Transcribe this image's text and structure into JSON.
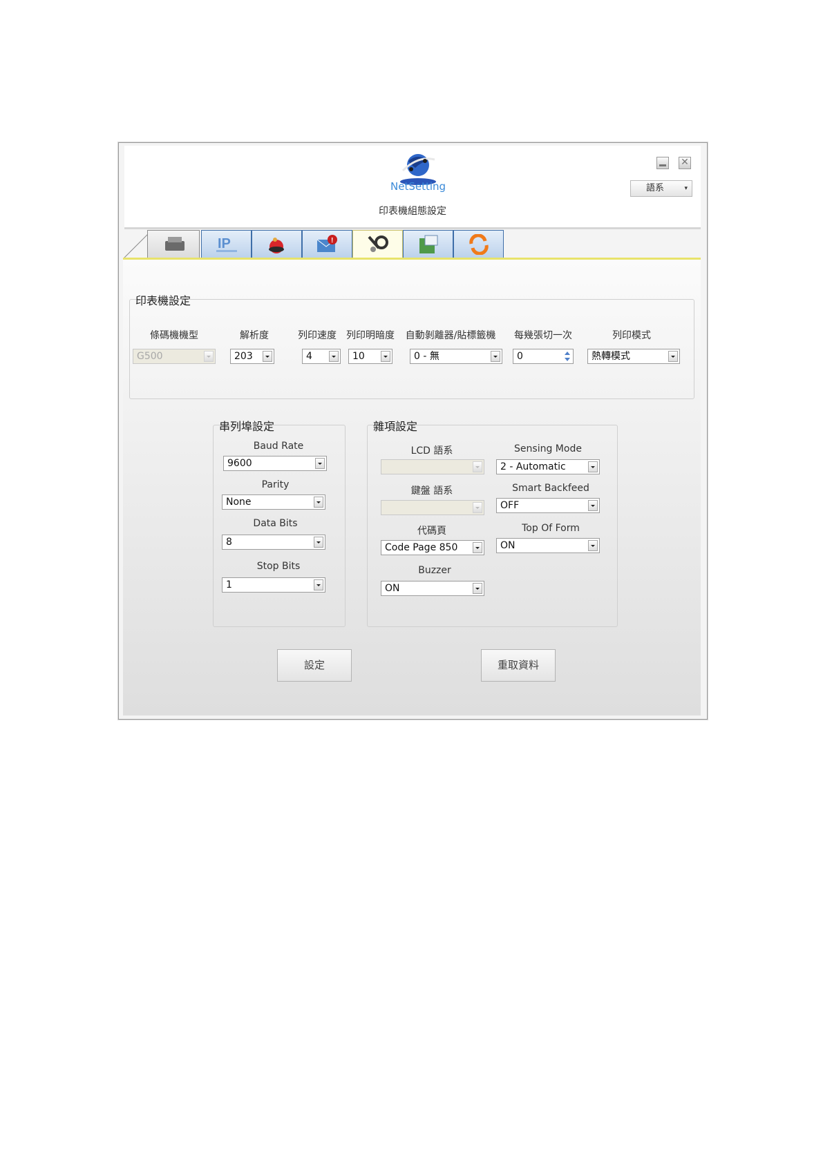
{
  "header": {
    "logo_text": "NetSetting",
    "subtitle": "印表機組態設定",
    "language_button": "語系",
    "minimize_icon": "minimize-icon",
    "close_icon": "close-icon"
  },
  "tabs": [
    {
      "icon": "printer-icon",
      "active": false
    },
    {
      "icon": "ip-network-icon",
      "active": false
    },
    {
      "icon": "red-ball-icon",
      "active": false
    },
    {
      "icon": "alert-mail-icon",
      "active": false
    },
    {
      "icon": "tools-gear-icon",
      "active": true
    },
    {
      "icon": "upload-file-icon",
      "active": false
    },
    {
      "icon": "refresh-icon",
      "active": false
    }
  ],
  "printer_settings": {
    "title": "印表機設定",
    "fields": [
      {
        "label": "條碼機機型",
        "value": "G500",
        "disabled": true
      },
      {
        "label": "解析度",
        "value": "203"
      },
      {
        "label": "列印速度",
        "value": "4"
      },
      {
        "label": "列印明暗度",
        "value": "10"
      },
      {
        "label": "自動剝離器/貼標籤機",
        "value": "0 - 無"
      },
      {
        "label": "每幾張切一次",
        "value": "0"
      },
      {
        "label": "列印模式",
        "value": "熱轉模式"
      }
    ]
  },
  "serial_settings": {
    "title": "串列埠設定",
    "fields": [
      {
        "label": "Baud Rate",
        "value": "9600"
      },
      {
        "label": "Parity",
        "value": "None"
      },
      {
        "label": "Data Bits",
        "value": "8"
      },
      {
        "label": "Stop Bits",
        "value": "1"
      }
    ]
  },
  "misc_settings": {
    "title": "雜項設定",
    "lcd_language": {
      "label": "LCD 語系",
      "value": ""
    },
    "keyboard_language": {
      "label": "鍵盤 語系",
      "value": ""
    },
    "code_page": {
      "label": "代碼頁",
      "value": "Code Page 850"
    },
    "buzzer": {
      "label": "Buzzer",
      "value": "ON"
    },
    "sensing_mode": {
      "label": "Sensing Mode",
      "value": "2 - Automatic"
    },
    "smart_backfeed": {
      "label": "Smart Backfeed",
      "value": "OFF"
    },
    "top_of_form": {
      "label": "Top Of Form",
      "value": "ON"
    }
  },
  "buttons": {
    "set": "設定",
    "reload": "重取資料"
  },
  "colors": {
    "tab_border": "#3e6ea8",
    "active_tab_line": "#e8e36a",
    "spinner_arrow": "#4f80c9"
  }
}
